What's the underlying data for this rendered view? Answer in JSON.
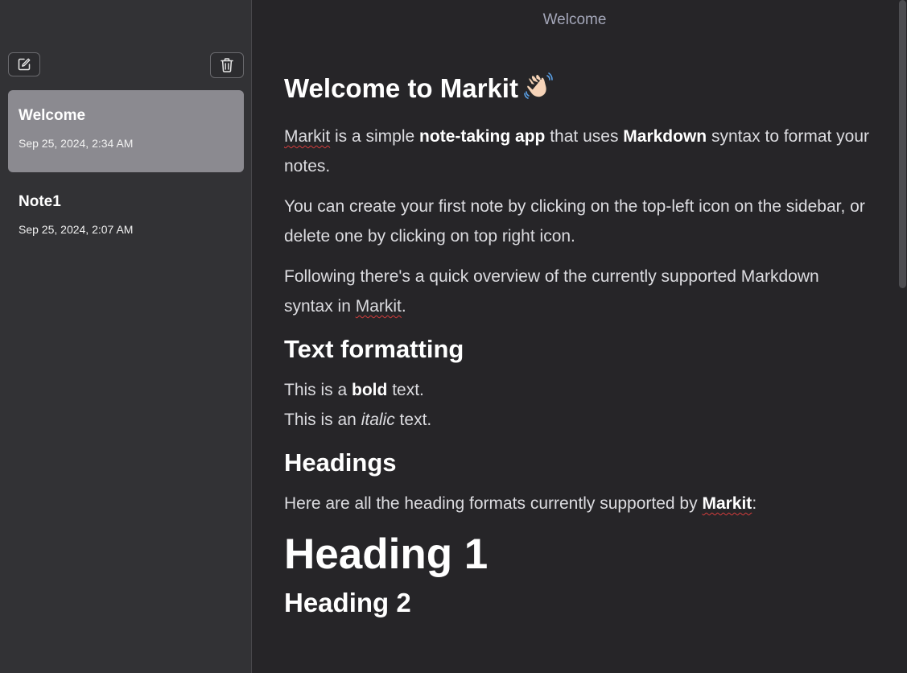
{
  "sidebar": {
    "new_note_icon": "edit-icon",
    "delete_note_icon": "trash-icon",
    "notes": [
      {
        "title": "Welcome",
        "date": "Sep 25, 2024, 2:34 AM",
        "active": true
      },
      {
        "title": "Note1",
        "date": "Sep 25, 2024, 2:07 AM",
        "active": false
      }
    ]
  },
  "editor": {
    "title": "Welcome",
    "h1_text": "Welcome to Markit",
    "h1_emoji": "waving-hand-icon",
    "intro": {
      "p1_a": "Markit",
      "p1_b": " is a simple ",
      "p1_bold1": "note-taking app",
      "p1_c": " that uses ",
      "p1_bold2": "Markdown",
      "p1_d": " syntax to format your notes.",
      "p2": "You can create your first note by clicking on the top-left icon on the sidebar, or delete one by clicking on top right icon.",
      "p3_a": "Following there's a quick overview of the currently supported Markdown syntax in ",
      "p3_b": "Markit",
      "p3_c": "."
    },
    "section_text_formatting": "Text formatting",
    "bold_line_a": "This is a ",
    "bold_word": "bold",
    "bold_line_b": " text.",
    "italic_line_a": "This is an ",
    "italic_word": "italic",
    "italic_line_b": " text.",
    "section_headings": "Headings",
    "headings_intro_a": "Here are all the heading formats currently supported by ",
    "headings_intro_b": "Markit",
    "headings_intro_c": ":",
    "heading1": "Heading 1",
    "heading2": "Heading 2"
  },
  "colors": {
    "sidebar_bg": "#323235",
    "main_bg": "#262528",
    "active_note_bg": "#8b8a90",
    "title_color": "#a3a6b8",
    "spellcheck": "#d23c3c"
  }
}
